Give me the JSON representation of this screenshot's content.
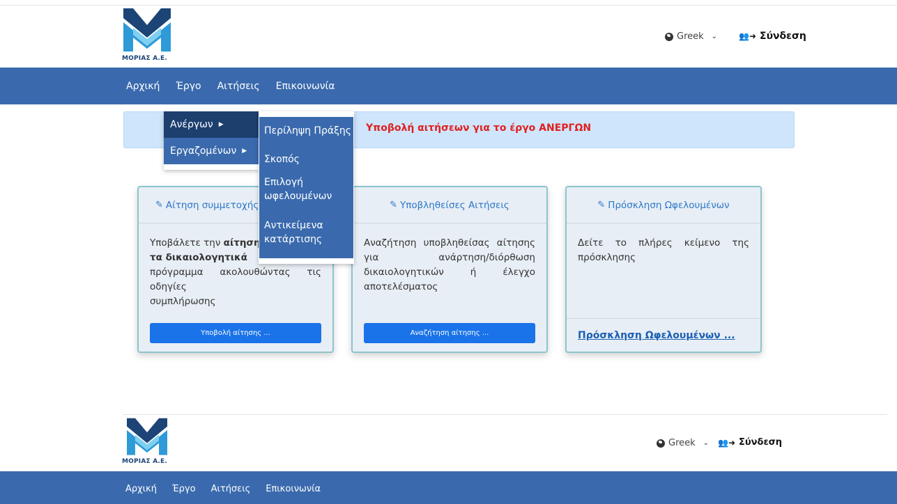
{
  "header": {
    "logo_text": "ΜΟΡΙΑΣ Α.Ε.",
    "language": "Greek",
    "login_label": "Σύνδεση",
    "icons": {
      "globe": "globe-icon",
      "chevron": "chevron-down-icon",
      "login": "user-login-icon"
    }
  },
  "nav": [
    "Αρχική",
    "Έργο",
    "Αιτήσεις",
    "Επικοινωνία"
  ],
  "alert": {
    "text": "Υποβολή αιτήσεων για το έργο  ΑΝΕΡΓΩΝ"
  },
  "dropdown": {
    "items": [
      "Ανέργων",
      "Εργαζομένων"
    ],
    "submenu": [
      "Περίληψη Πράξης",
      "Σκοπός",
      "Επιλογή ωφελουμένων",
      "Αντικείμενα κατάρτισης"
    ]
  },
  "cards": [
    {
      "title": "Αίτηση συμμετοχής ω",
      "body_pre": "Υποβάλετε την ",
      "body_bold": "αίτηση συ",
      "body_line2_bold": "τα   δικαιολογητικά",
      "body_line3": "πρόγραμμα ακολουθώντας τις οδηγίες",
      "body_line4": "συμπλήρωσης",
      "button": "Υποβολή αίτησης ..."
    },
    {
      "title": "Υποβληθείσες Αιτήσεις",
      "body": "Αναζήτηση υποβληθείσας αίτησης για ανάρτηση/διόρθωση δικαιολογητικών ή έλεγχο αποτελέσματος",
      "button": "Αναζήτηση αίτησης ..."
    },
    {
      "title": "Πρόσκληση Ωφελουμένων",
      "body": "Δείτε το πλήρες κείμενο της πρόσκλησης",
      "link": "Πρόσκληση Ωφελουμένων ..."
    }
  ],
  "colors": {
    "navbar": "#3a6aad",
    "alert_bg": "#cfe5fb",
    "alert_text": "#e02020",
    "button": "#1a73e8",
    "card_border": "#8cc5cc",
    "dropdown_active": "#1c3f6e"
  }
}
